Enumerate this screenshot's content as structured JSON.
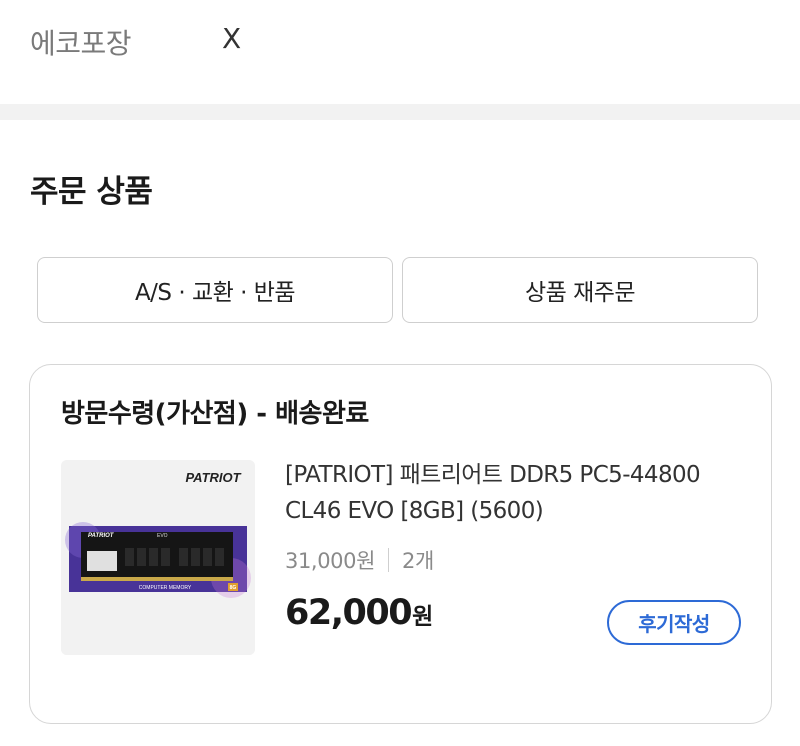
{
  "packaging": {
    "label": "에코포장",
    "value": "X"
  },
  "section": {
    "title": "주문 상품"
  },
  "actions": {
    "as_exchange_return": "A/S · 교환 · 반품",
    "reorder": "상품 재주문"
  },
  "order": {
    "status": "방문수령(가산점) - 배송완료",
    "product": {
      "name_line1": "[PATRIOT] 패트리어트 DDR5 PC5-44800",
      "name_line2": "CL46 EVO [8GB] (5600)",
      "unit_price": "31,000원",
      "quantity": "2개",
      "total_amount": "62,000",
      "total_currency": "원",
      "image": {
        "brand": "PATRIOT",
        "module_brand": "PATRIOT",
        "module_series": "EVO",
        "caption": "COMPUTER MEMORY",
        "capacity": "8G"
      }
    },
    "review_button": "후기작성"
  },
  "colors": {
    "accent": "#2d6ad6",
    "divider": "#f2f2f2",
    "border": "#d6d6d6"
  }
}
